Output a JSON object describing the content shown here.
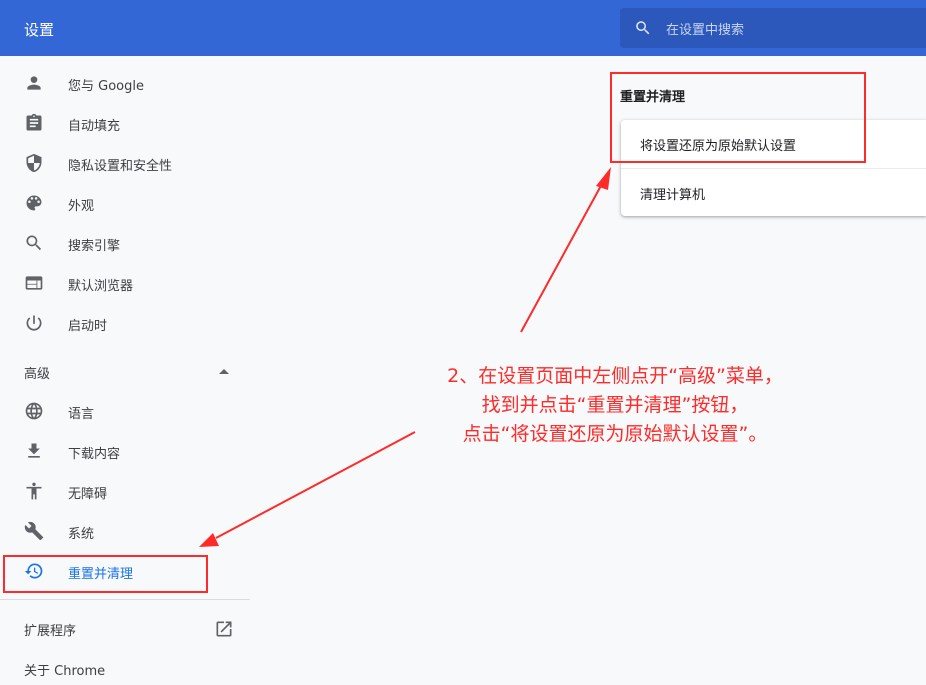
{
  "header": {
    "title": "设置",
    "search_placeholder": "在设置中搜索"
  },
  "sidebar": {
    "items": [
      {
        "label": "您与 Google",
        "icon": "person-icon"
      },
      {
        "label": "自动填充",
        "icon": "clipboard-icon"
      },
      {
        "label": "隐私设置和安全性",
        "icon": "shield-icon"
      },
      {
        "label": "外观",
        "icon": "palette-icon"
      },
      {
        "label": "搜索引擎",
        "icon": "search-icon"
      },
      {
        "label": "默认浏览器",
        "icon": "browser-window-icon"
      },
      {
        "label": "启动时",
        "icon": "power-icon"
      }
    ],
    "advanced_label": "高级",
    "advanced_items": [
      {
        "label": "语言",
        "icon": "globe-icon"
      },
      {
        "label": "下载内容",
        "icon": "download-icon"
      },
      {
        "label": "无障碍",
        "icon": "accessibility-icon"
      },
      {
        "label": "系统",
        "icon": "wrench-icon"
      },
      {
        "label": "重置并清理",
        "icon": "history-reset-icon",
        "active": true
      }
    ],
    "extensions_label": "扩展程序",
    "about_label": "关于 Chrome"
  },
  "main": {
    "section_title": "重置并清理",
    "rows": [
      {
        "label": "将设置还原为原始默认设置"
      },
      {
        "label": "清理计算机"
      }
    ]
  },
  "annotation": {
    "lines": [
      "2、在设置页面中左侧点开“高级”菜单，",
      "找到并点击“重置并清理”按钮，",
      "点击“将设置还原为原始默认设置”。"
    ]
  },
  "colors": {
    "header": "#3367d6",
    "accent": "#1a73e8",
    "annotation": "#ff2a2a"
  }
}
